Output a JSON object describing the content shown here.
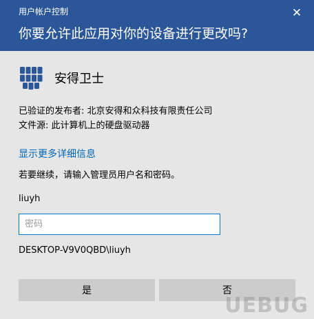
{
  "window": {
    "title": "用户帐户控制"
  },
  "header": {
    "question": "你要允许此应用对你的设备进行更改吗?"
  },
  "app": {
    "name": "安得卫士",
    "icon": "app-shield-icon",
    "icon_color": "#2b579a"
  },
  "details": {
    "publisher": "已验证的发布者: 北京安得和众科技有限责任公司",
    "origin": "文件源: 此计算机上的硬盘驱动器"
  },
  "more_info_link": "显示更多详细信息",
  "continue_text": "若要继续，请输入管理员用户名和密码。",
  "username": "liuyh",
  "password_field": {
    "placeholder": "密码",
    "value": ""
  },
  "domain_user": "DESKTOP-V9V0QBD\\liuyh",
  "buttons": {
    "yes": "是",
    "no": "否"
  },
  "watermark": "UEBUG",
  "colors": {
    "header_bg": "#2b579a",
    "link": "#0067b8",
    "button_bg": "#cccccc",
    "dialog_bg": "#e6e6e6"
  }
}
